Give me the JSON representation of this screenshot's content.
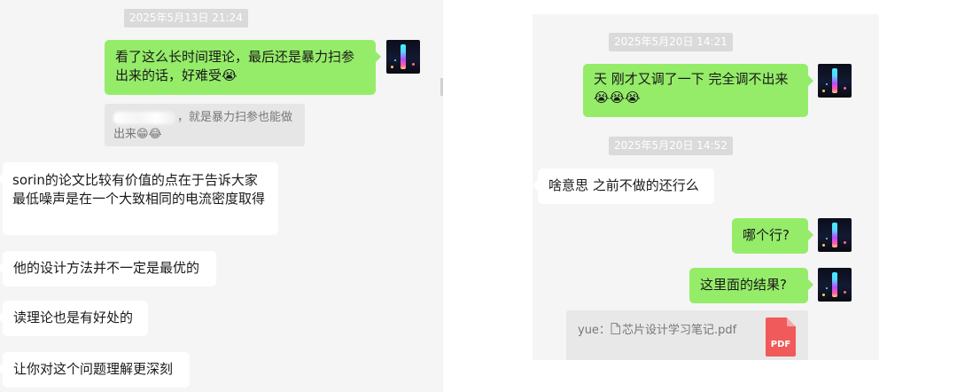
{
  "left": {
    "time": "2025年5月13日 21:24",
    "messages": [
      {
        "side": "me",
        "text": "看了这么长时间理论，最后还是暴力扫参出来的话，好难受😭"
      },
      {
        "side": "other",
        "text": "sorin的论文比较有价值的点在于告诉大家最低噪声是在一个大致相同的电流密度取得"
      },
      {
        "side": "other",
        "text": "他的设计方法并不一定是最优的"
      },
      {
        "side": "other",
        "text": "读理论也是有好处的"
      },
      {
        "side": "other",
        "text": "让你对这个问题理解更深刻"
      }
    ],
    "quote": {
      "line1": "，就是暴力扫参也能做",
      "line2": "出来😁😂"
    }
  },
  "right": {
    "time1": "2025年5月20日 14:21",
    "time2": "2025年5月20日 14:52",
    "messages": [
      {
        "side": "me",
        "line1": "天 刚才又调了一下 完全调不出来",
        "line2": "😭😭😭"
      },
      {
        "side": "other",
        "text": "啥意思 之前不做的还行么"
      },
      {
        "side": "me",
        "text": "哪个行?"
      },
      {
        "side": "me",
        "text": "这里面的结果?"
      }
    ],
    "file": {
      "sender": "yue：",
      "icon": "document-icon",
      "name": "芯片设计学习笔记.pdf",
      "badge": "PDF"
    }
  },
  "colors": {
    "my_bubble": "#95ec69",
    "other_bubble": "#ffffff",
    "background": "#f5f5f5",
    "pdf": "#f05a5a"
  }
}
